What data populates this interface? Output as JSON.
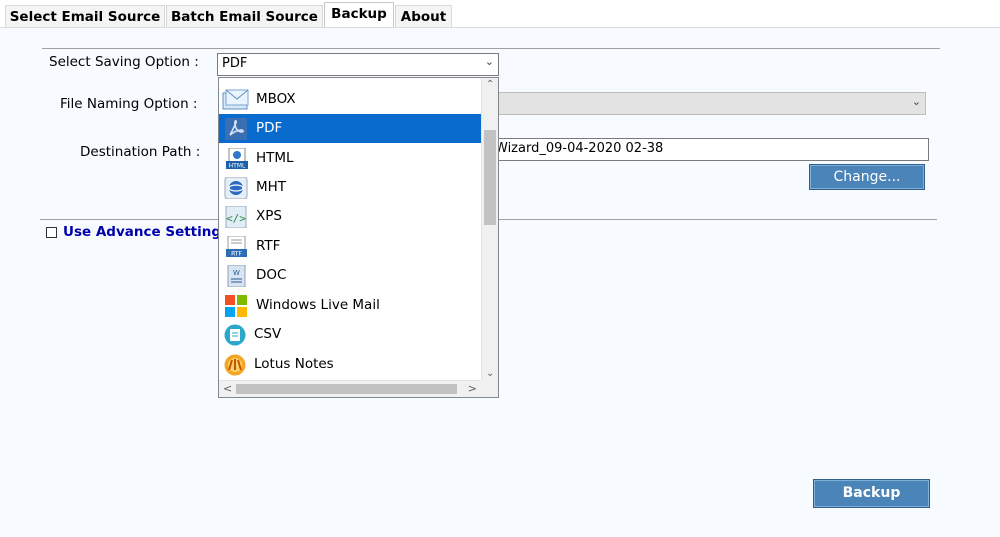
{
  "tabs": [
    {
      "label": "Select Email Source"
    },
    {
      "label": "Batch Email Source"
    },
    {
      "label": "Backup"
    },
    {
      "label": "About"
    }
  ],
  "backup": {
    "saving_option_label": "Select Saving Option :",
    "saving_option_value": "PDF",
    "file_naming_label": "File Naming Option :",
    "destination_label": "Destination Path :",
    "destination_value": "Wizard_09-04-2020 02-38",
    "change_button": "Change...",
    "advance_settings_label": "Use Advance Settings",
    "backup_button": "Backup"
  },
  "dropdown": {
    "items": [
      {
        "label": "MBOX",
        "icon": "mbox-icon"
      },
      {
        "label": "PDF",
        "icon": "pdf-icon",
        "selected": true
      },
      {
        "label": "HTML",
        "icon": "html-icon"
      },
      {
        "label": "MHT",
        "icon": "mht-icon"
      },
      {
        "label": "XPS",
        "icon": "xps-icon"
      },
      {
        "label": "RTF",
        "icon": "rtf-icon"
      },
      {
        "label": "DOC",
        "icon": "doc-icon"
      },
      {
        "label": "Windows Live Mail",
        "icon": "windows-live-mail-icon"
      },
      {
        "label": "CSV",
        "icon": "csv-icon"
      },
      {
        "label": "Lotus Notes",
        "icon": "lotus-notes-icon"
      }
    ]
  },
  "colors": {
    "accent": "#0a6bcf",
    "button": "#4a84b8",
    "link_blue": "#0000aa",
    "panel_bg": "#f7fbff"
  }
}
